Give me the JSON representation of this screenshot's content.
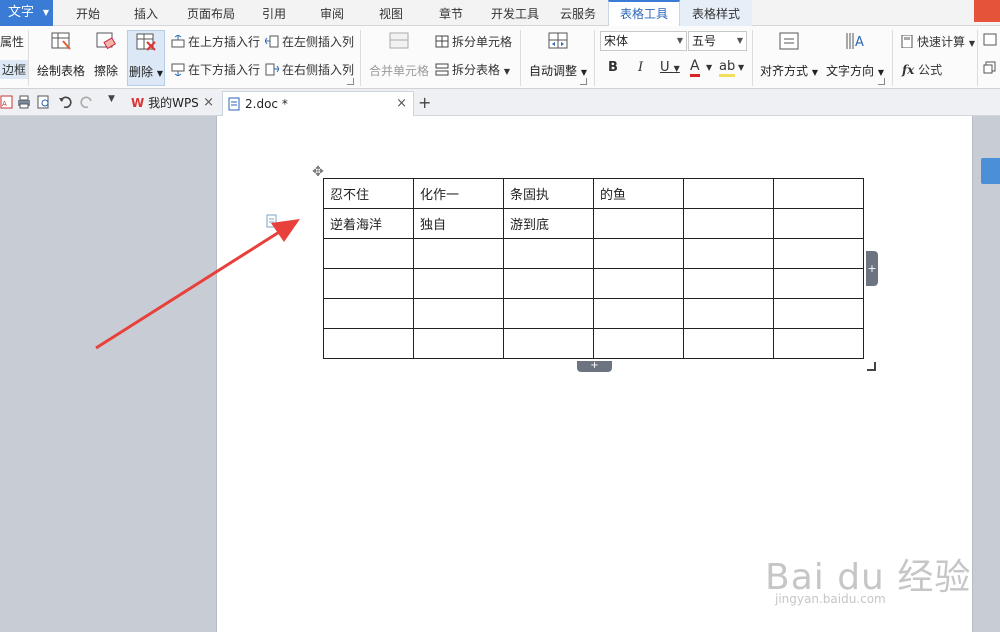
{
  "app": {
    "name": "文字",
    "icon": "wps-writer-icon"
  },
  "tabs": [
    {
      "label": "开始"
    },
    {
      "label": "插入"
    },
    {
      "label": "页面布局"
    },
    {
      "label": "引用"
    },
    {
      "label": "审阅"
    },
    {
      "label": "视图"
    },
    {
      "label": "章节"
    },
    {
      "label": "开发工具"
    },
    {
      "label": "云服务"
    },
    {
      "label": "表格工具"
    },
    {
      "label": "表格样式"
    }
  ],
  "active_tab": "表格工具",
  "ribbon": {
    "properties": "属性",
    "borders": "边框",
    "draw_table": "绘制表格",
    "erase": "擦除",
    "delete": "删除",
    "insert_above": "在上方插入行",
    "insert_below": "在下方插入行",
    "insert_left": "在左侧插入列",
    "insert_right": "在右侧插入列",
    "merge_cells": "合并单元格",
    "split_cells": "拆分单元格",
    "split_table": "拆分表格",
    "auto_fit": "自动调整",
    "font_name": "宋体",
    "font_size": "五号",
    "bold": "B",
    "italic": "I",
    "underline": "U",
    "font_color": "A",
    "highlight": "ab",
    "align": "对齐方式",
    "text_direction": "文字方向",
    "quick_calc": "快速计算",
    "formula": "公式",
    "fx": "fx"
  },
  "doc_tabs": [
    {
      "label": "我的WPS",
      "close": "×"
    },
    {
      "label": "2.doc *",
      "close": "×"
    }
  ],
  "new_tab": "+",
  "table": {
    "rows": [
      [
        "忍不住",
        "化作一",
        "条固执",
        "的鱼",
        "",
        ""
      ],
      [
        "逆着海洋",
        "独自",
        "游到底",
        "",
        "",
        ""
      ],
      [
        "",
        "",
        "",
        "",
        "",
        ""
      ],
      [
        "",
        "",
        "",
        "",
        "",
        ""
      ],
      [
        "",
        "",
        "",
        "",
        "",
        ""
      ],
      [
        "",
        "",
        "",
        "",
        "",
        ""
      ]
    ]
  },
  "table_controls": {
    "add": "+"
  },
  "watermark": {
    "main": "Bai du 经验",
    "sub": "jingyan.baidu.com"
  },
  "colors": {
    "accent": "#3a7bd5",
    "arrow": "#e8403a"
  }
}
